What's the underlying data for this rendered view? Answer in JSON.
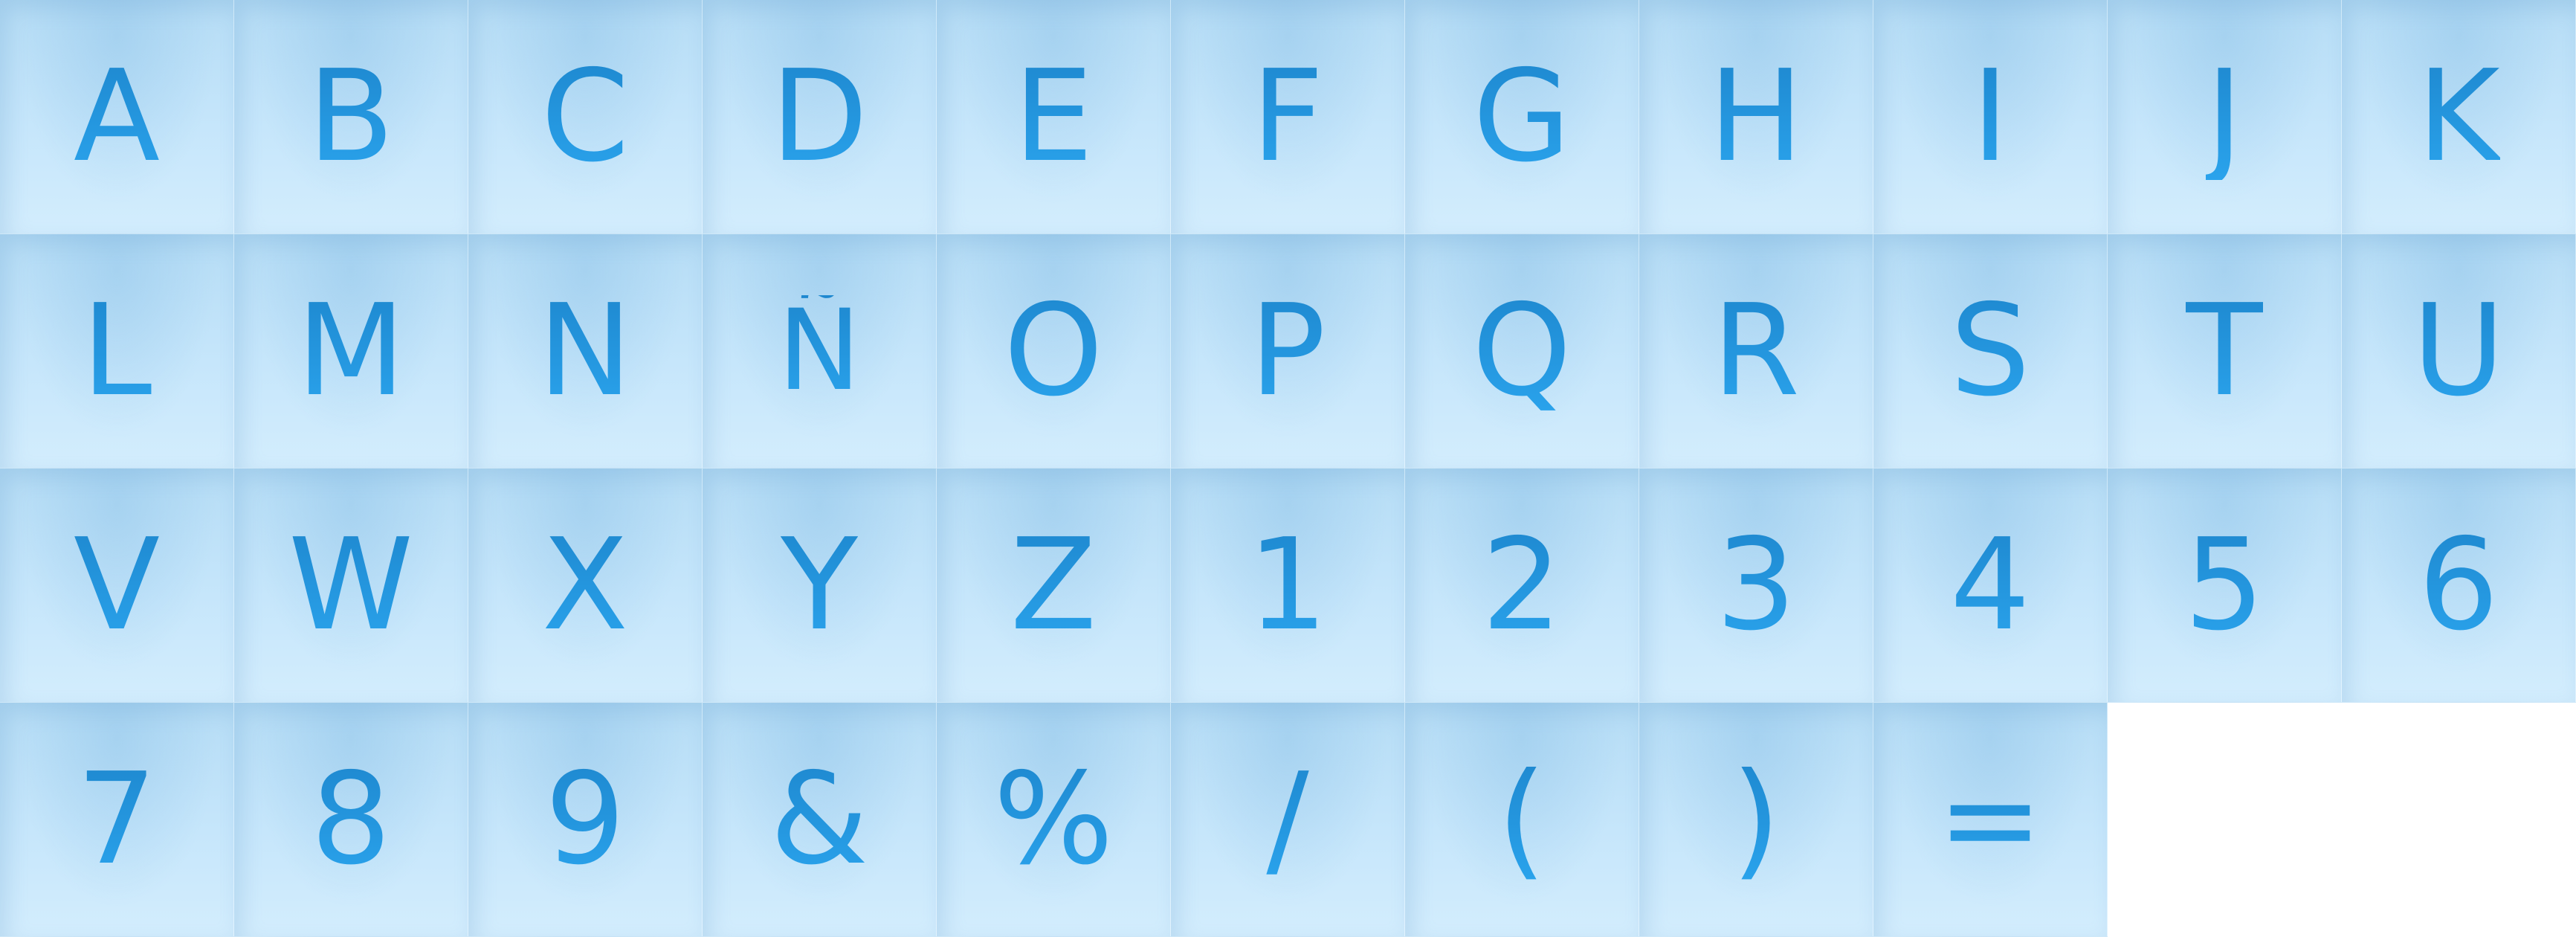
{
  "tiles": [
    {
      "glyph": "A",
      "name": "letter-a"
    },
    {
      "glyph": "B",
      "name": "letter-b"
    },
    {
      "glyph": "C",
      "name": "letter-c"
    },
    {
      "glyph": "D",
      "name": "letter-d"
    },
    {
      "glyph": "E",
      "name": "letter-e"
    },
    {
      "glyph": "F",
      "name": "letter-f"
    },
    {
      "glyph": "G",
      "name": "letter-g"
    },
    {
      "glyph": "H",
      "name": "letter-h"
    },
    {
      "glyph": "I",
      "name": "letter-i"
    },
    {
      "glyph": "J",
      "name": "letter-j"
    },
    {
      "glyph": "K",
      "name": "letter-k"
    },
    {
      "glyph": "L",
      "name": "letter-l"
    },
    {
      "glyph": "M",
      "name": "letter-m"
    },
    {
      "glyph": "N",
      "name": "letter-n"
    },
    {
      "glyph": "Ñ",
      "name": "letter-n-tilde"
    },
    {
      "glyph": "O",
      "name": "letter-o"
    },
    {
      "glyph": "P",
      "name": "letter-p"
    },
    {
      "glyph": "Q",
      "name": "letter-q"
    },
    {
      "glyph": "R",
      "name": "letter-r"
    },
    {
      "glyph": "S",
      "name": "letter-s"
    },
    {
      "glyph": "T",
      "name": "letter-t"
    },
    {
      "glyph": "U",
      "name": "letter-u"
    },
    {
      "glyph": "V",
      "name": "letter-v"
    },
    {
      "glyph": "W",
      "name": "letter-w"
    },
    {
      "glyph": "X",
      "name": "letter-x"
    },
    {
      "glyph": "Y",
      "name": "letter-y"
    },
    {
      "glyph": "Z",
      "name": "letter-z"
    },
    {
      "glyph": "1",
      "name": "digit-1"
    },
    {
      "glyph": "2",
      "name": "digit-2"
    },
    {
      "glyph": "3",
      "name": "digit-3"
    },
    {
      "glyph": "4",
      "name": "digit-4"
    },
    {
      "glyph": "5",
      "name": "digit-5"
    },
    {
      "glyph": "6",
      "name": "digit-6"
    },
    {
      "glyph": "7",
      "name": "digit-7"
    },
    {
      "glyph": "8",
      "name": "digit-8"
    },
    {
      "glyph": "9",
      "name": "digit-9"
    },
    {
      "glyph": "&",
      "name": "ampersand"
    },
    {
      "glyph": "%",
      "name": "percent"
    },
    {
      "glyph": "/",
      "name": "slash"
    },
    {
      "glyph": "(",
      "name": "left-parenthesis"
    },
    {
      "glyph": ")",
      "name": "right-parenthesis"
    },
    {
      "glyph": "=",
      "name": "equals"
    }
  ],
  "colors": {
    "glyph_top": "#1e88cf",
    "glyph_bottom": "#2aa3ec",
    "tile_top": "#b5dcf5",
    "tile_bottom": "#d3edfd",
    "background": "#ffffff"
  }
}
